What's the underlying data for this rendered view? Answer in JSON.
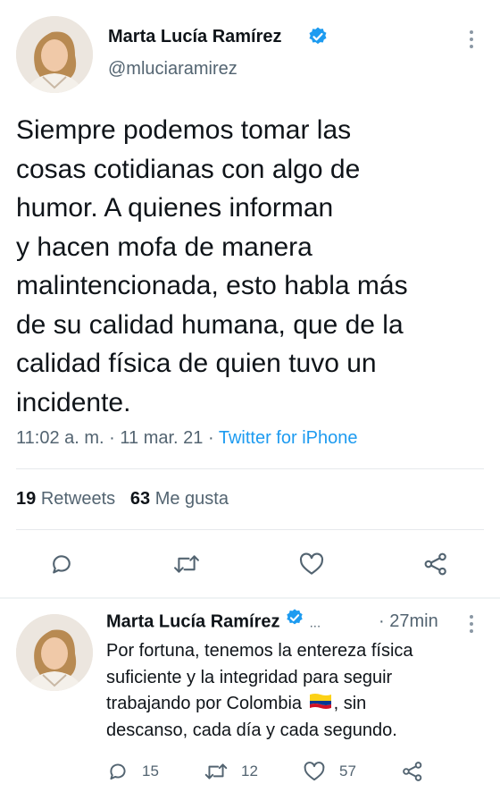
{
  "main_tweet": {
    "author_name": "Marta Lucía Ramírez",
    "handle": "@mluciaramirez",
    "text_lines": [
      "Siempre podemos tomar las",
      "cosas cotidianas con algo de",
      "humor. A quienes informan",
      "y hacen mofa de manera",
      "malintencionada, esto habla más",
      "de su calidad humana, que de la",
      "calidad física de quien tuvo un",
      "incidente."
    ],
    "time": "11:02 a. m.",
    "sep1": "·",
    "date": "11 mar. 21",
    "sep2": "·",
    "source": "Twitter for iPhone",
    "retweets_count": "19",
    "retweets_label": "Retweets",
    "likes_count": "63",
    "likes_label": "Me gusta"
  },
  "reply_tweet": {
    "author_name": "Marta Lucía Ramírez",
    "ellipsis": "...",
    "age": "· 27min",
    "text_lines": [
      "Por fortuna, tenemos la entereza física",
      "suficiente y la integridad para seguir",
      "trabajando por Colombia",
      "descanso, cada día y cada segundo."
    ],
    "line3_suffix": ", sin",
    "replies": "15",
    "retweets": "12",
    "likes": "57"
  },
  "colors": {
    "link": "#1d9bf0",
    "verified": "#1d9bf0",
    "text": "#0f1419",
    "secondary": "#536471"
  },
  "icons": [
    "verified-badge-icon",
    "more-options-icon",
    "reply-icon",
    "retweet-icon",
    "like-icon",
    "share-icon",
    "colombia-flag-icon"
  ]
}
